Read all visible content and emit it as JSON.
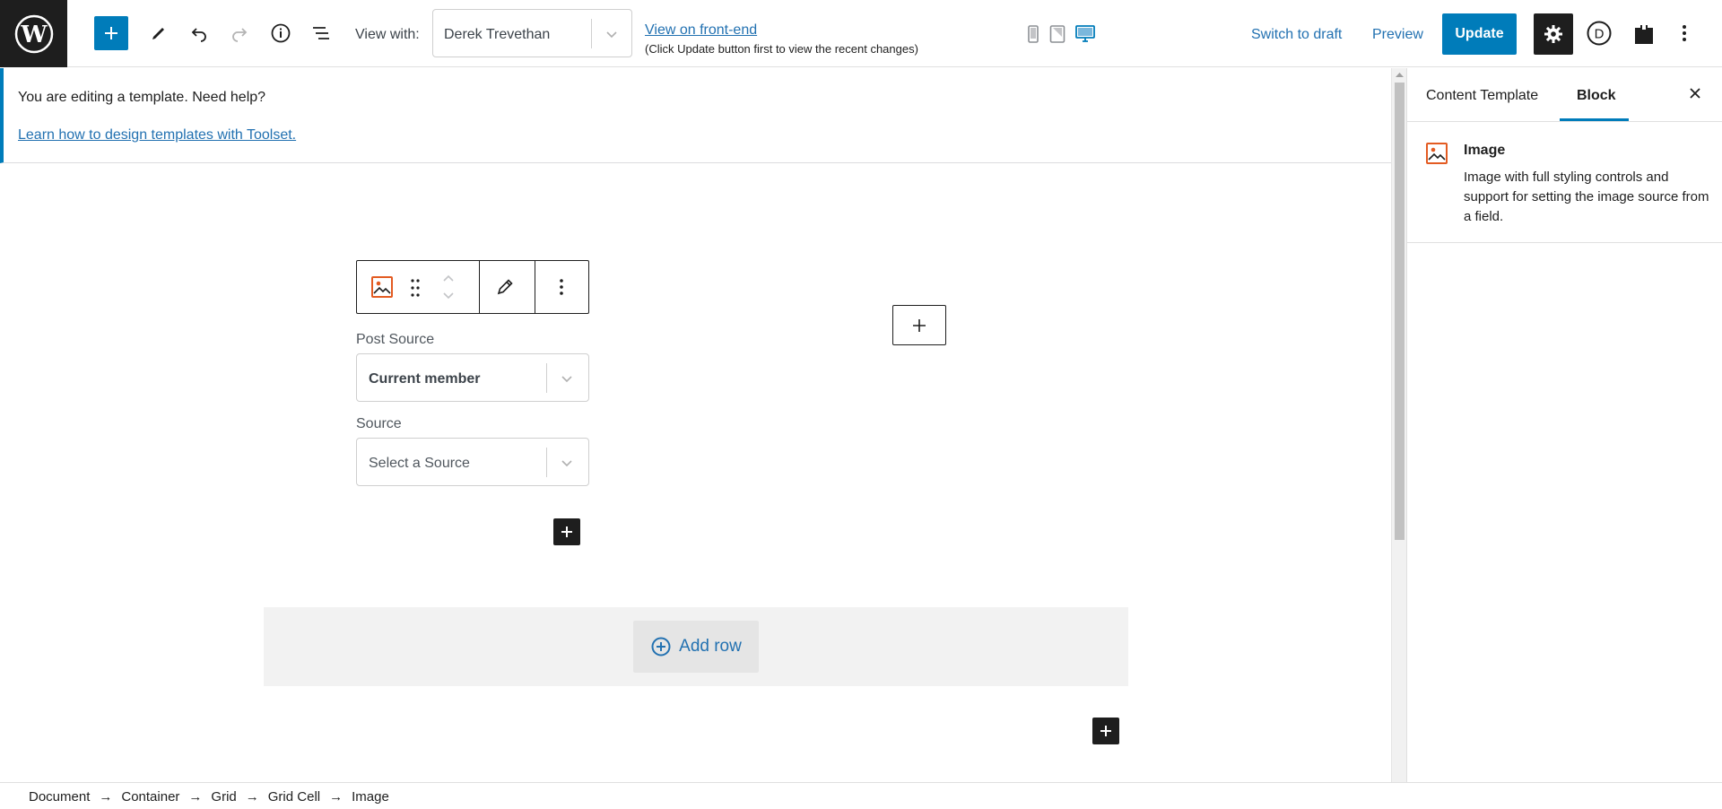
{
  "topbar": {
    "view_with_label": "View with:",
    "view_with_value": "Derek Trevethan",
    "frontend_link": "View on front-end",
    "frontend_note": "(Click Update button first to view the recent changes)",
    "switch_to_draft": "Switch to draft",
    "preview": "Preview",
    "update": "Update",
    "accent_color": "#007cba",
    "device_active": "desktop"
  },
  "notice": {
    "text": "You are editing a template. Need help?",
    "link": "Learn how to design templates with Toolset."
  },
  "block": {
    "post_source_label": "Post Source",
    "post_source_value": "Current member",
    "source_label": "Source",
    "source_placeholder": "Select a Source"
  },
  "add_row": {
    "label": "Add row"
  },
  "sidebar": {
    "tabs": [
      "Content Template",
      "Block"
    ],
    "active_tab": "Block",
    "block_title": "Image",
    "block_description": "Image with full styling controls and support for setting the image source from a field."
  },
  "breadcrumb": [
    "Document",
    "Container",
    "Grid",
    "Grid Cell",
    "Image"
  ]
}
